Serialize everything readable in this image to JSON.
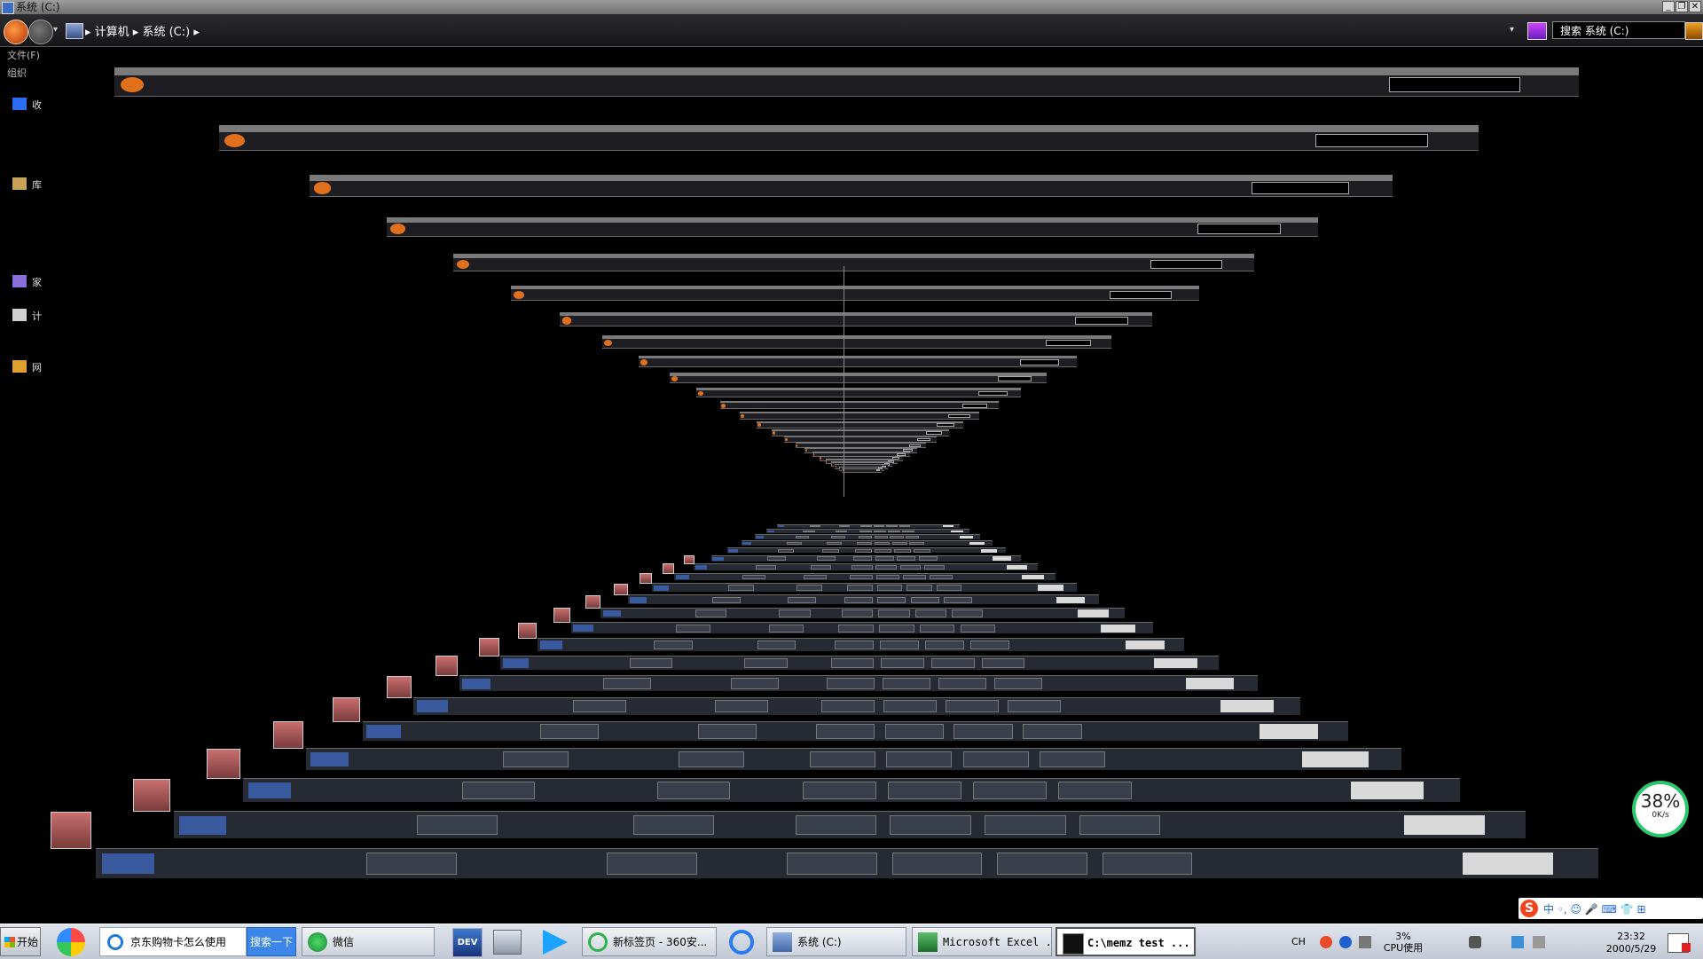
{
  "window": {
    "title": "系统 (C:)",
    "controls": [
      "_",
      "❐",
      "✕"
    ],
    "address": "▸ 计算机 ▸ 系统 (C:) ▸",
    "search_placeholder": "搜索 系统 (C:)",
    "menu": [
      "文件(F)",
      "组织"
    ],
    "sidebar": [
      "收",
      "库",
      "家",
      "计",
      "网"
    ]
  },
  "taskbar": {
    "start_label": "开始",
    "ie_text": "京东购物卡怎么使用",
    "search_button": "搜索一下",
    "wechat": "微信",
    "dev_label": "DEV",
    "browser360": "新标签页 - 360安...",
    "explorer": "系统 (C:)",
    "excel": "Microsoft Excel ...",
    "cmd": "C:\\memz test ...",
    "lang": "CH",
    "cpu": "3%",
    "cpu_label": "CPU使用",
    "time": "23:32",
    "date": "2000/5/29"
  },
  "widget": {
    "percent": "38%",
    "speed": "0K/s"
  },
  "ime": {
    "logo": "S",
    "text": "中 ◦, ☺ 🎤 ⌨ 👕 ⊞"
  },
  "colors": {
    "accent": "#2dc46c",
    "taskbar_bg": "#cdd3dc",
    "tunnel_bg": "#000000"
  },
  "icons": [
    "start-icon",
    "qq-icon",
    "ie-icon",
    "wechat-icon",
    "dev-icon",
    "ink-icon",
    "play-icon",
    "browser360-icon",
    "baidu-icon",
    "explorer-icon",
    "excel-icon",
    "cmd-icon",
    "sogou-icon",
    "help-icon",
    "volume-icon",
    "network-icon",
    "notify-icon"
  ]
}
